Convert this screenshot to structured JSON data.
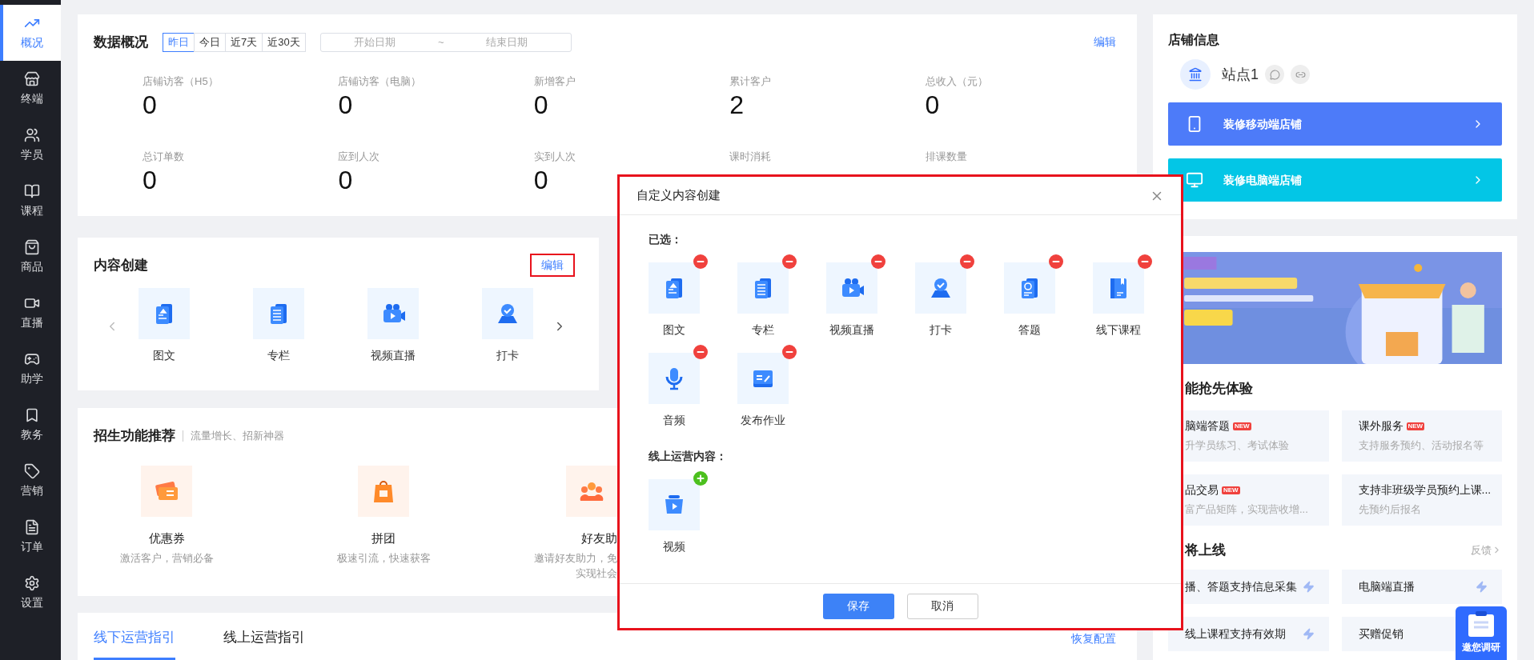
{
  "sidebar": {
    "items": [
      {
        "label": "概况",
        "selected": true
      },
      {
        "label": "终端",
        "selected": false
      },
      {
        "label": "学员",
        "selected": false
      },
      {
        "label": "课程",
        "selected": false
      },
      {
        "label": "商品",
        "selected": false
      },
      {
        "label": "直播",
        "selected": false
      },
      {
        "label": "助学",
        "selected": false
      },
      {
        "label": "教务",
        "selected": false
      },
      {
        "label": "营销",
        "selected": false
      },
      {
        "label": "订单",
        "selected": false
      },
      {
        "label": "设置",
        "selected": false
      }
    ]
  },
  "overview": {
    "title": "数据概况",
    "ranges": [
      {
        "label": "昨日",
        "selected": true
      },
      {
        "label": "今日",
        "selected": false
      },
      {
        "label": "近7天",
        "selected": false
      },
      {
        "label": "近30天",
        "selected": false
      }
    ],
    "date_range": {
      "start_placeholder": "开始日期",
      "separator": "~",
      "end_placeholder": "结束日期"
    },
    "edit": "编辑",
    "stats": [
      {
        "label": "店铺访客（H5）",
        "value": "0"
      },
      {
        "label": "店铺访客（电脑）",
        "value": "0"
      },
      {
        "label": "新增客户",
        "value": "0"
      },
      {
        "label": "累计客户",
        "value": "2"
      },
      {
        "label": "总收入（元）",
        "value": "0"
      },
      {
        "label": "总订单数",
        "value": "0"
      },
      {
        "label": "应到人次",
        "value": "0"
      },
      {
        "label": "实到人次",
        "value": "0"
      },
      {
        "label": "课时消耗"
      },
      {
        "label": "排课数量"
      }
    ]
  },
  "content_creation": {
    "title": "内容创建",
    "edit": "编辑",
    "edit_highlighted": true,
    "items": [
      {
        "label": "图文"
      },
      {
        "label": "专栏"
      },
      {
        "label": "视频直播"
      },
      {
        "label": "打卡"
      }
    ]
  },
  "recruit": {
    "title": "招生功能推荐",
    "subtitle": "流量增长、招新神器",
    "items": [
      {
        "label": "优惠券",
        "desc_lines": [
          "激活客户，营销必备"
        ]
      },
      {
        "label": "拼团",
        "desc_lines": [
          "极速引流，快速获客"
        ]
      },
      {
        "label": "好友助",
        "desc_lines": [
          "邀请好友助力，免",
          "实现社会"
        ]
      }
    ]
  },
  "guide": {
    "tabs": [
      {
        "label": "线下运营指引",
        "selected": true
      },
      {
        "label": "线上运营指引",
        "selected": false
      }
    ],
    "reset": "恢复配置"
  },
  "store": {
    "title": "店铺信息",
    "name": "站点1",
    "actions": [
      {
        "label": "装修移动端店铺",
        "kind": "mobile"
      },
      {
        "label": "装修电脑端店铺",
        "kind": "desktop"
      }
    ]
  },
  "features": {
    "title": "能抢先体验",
    "items": [
      {
        "title": "脑端答题",
        "badge": "NEW",
        "desc": "升学员练习、考试体验"
      },
      {
        "title": "课外服务",
        "badge": "NEW",
        "desc": "支持服务预约、活动报名等"
      },
      {
        "title": "品交易",
        "badge": "NEW",
        "desc": "富产品矩阵，实现营收增..."
      },
      {
        "title": "支持非班级学员预约上课...",
        "desc": "先预约后报名"
      }
    ],
    "upcoming_title": "将上线",
    "feedback": "反馈",
    "upcoming": [
      {
        "label": "播、答题支持信息采集"
      },
      {
        "label": "电脑端直播"
      },
      {
        "label": "线上课程支持有效期"
      },
      {
        "label": "买赠促销"
      }
    ]
  },
  "survey": {
    "label": "邀您调研"
  },
  "modal": {
    "title": "自定义内容创建",
    "highlighted": true,
    "sections": [
      {
        "title": "已选：",
        "items": [
          {
            "label": "图文",
            "kind": "remove"
          },
          {
            "label": "专栏",
            "kind": "remove"
          },
          {
            "label": "视频直播",
            "kind": "remove"
          },
          {
            "label": "打卡",
            "kind": "remove"
          },
          {
            "label": "答题",
            "kind": "remove"
          },
          {
            "label": "线下课程",
            "kind": "remove"
          },
          {
            "label": "音频",
            "kind": "remove"
          },
          {
            "label": "发布作业",
            "kind": "remove"
          }
        ]
      },
      {
        "title": "线上运营内容：",
        "items": [
          {
            "label": "视频",
            "kind": "add"
          }
        ]
      }
    ],
    "buttons": [
      {
        "label": "保存",
        "kind": "primary"
      },
      {
        "label": "取消",
        "kind": "default"
      }
    ]
  }
}
